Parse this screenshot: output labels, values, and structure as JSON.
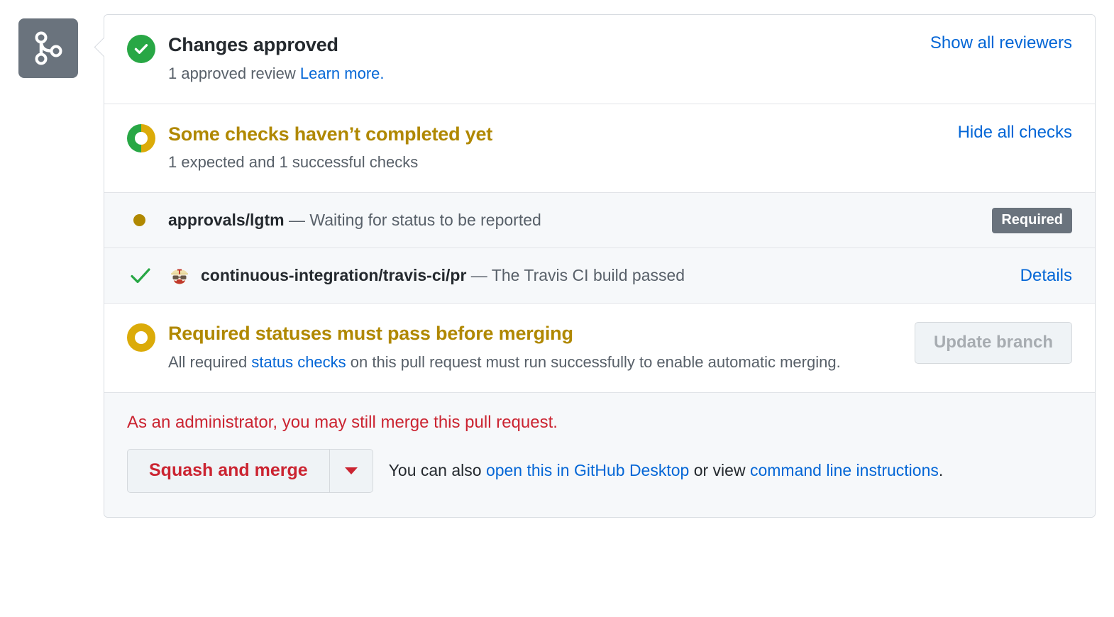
{
  "badge": {
    "icon": "git-merge-icon"
  },
  "review": {
    "icon": "check-circle-icon",
    "heading": "Changes approved",
    "sub_prefix": "1 approved review ",
    "learn_more": "Learn more.",
    "action_link": "Show all reviewers"
  },
  "checks_summary": {
    "icon": "half-donut-icon",
    "heading": "Some checks haven’t completed yet",
    "sub": "1 expected and 1 successful checks",
    "action_link": "Hide all checks"
  },
  "checks": [
    {
      "status_icon": "pending-dot-icon",
      "avatar": null,
      "name": "approvals/lgtm",
      "dash": " — ",
      "description": "Waiting for status to be reported",
      "badge": "Required",
      "details_link": null
    },
    {
      "status_icon": "check-mark-icon",
      "avatar": "travis-ci-avatar",
      "name": "continuous-integration/travis-ci/pr",
      "dash": " — ",
      "description": "The Travis CI build passed",
      "badge": null,
      "details_link": "Details"
    }
  ],
  "required_statuses": {
    "icon": "warning-ring-icon",
    "heading": "Required statuses must pass before merging",
    "body_prefix": "All required ",
    "body_link": "status checks",
    "body_suffix": " on this pull request must run successfully to enable automatic merging.",
    "update_button": "Update branch"
  },
  "merge_footer": {
    "admin_note": "As an administrator, you may still merge this pull request.",
    "merge_button": "Squash and merge",
    "caret_icon": "chevron-down-icon",
    "hint_prefix": "You can also ",
    "hint_link_desktop": "open this in GitHub Desktop",
    "hint_middle": " or view ",
    "hint_link_cli": "command line instructions",
    "hint_suffix": "."
  },
  "colors": {
    "success_green": "#28a745",
    "warning_gold": "#dbab09",
    "warning_text": "#b08800",
    "link_blue": "#0366d6",
    "danger_red": "#cb2431",
    "muted_gray": "#586069",
    "badge_gray": "#6a737d"
  }
}
